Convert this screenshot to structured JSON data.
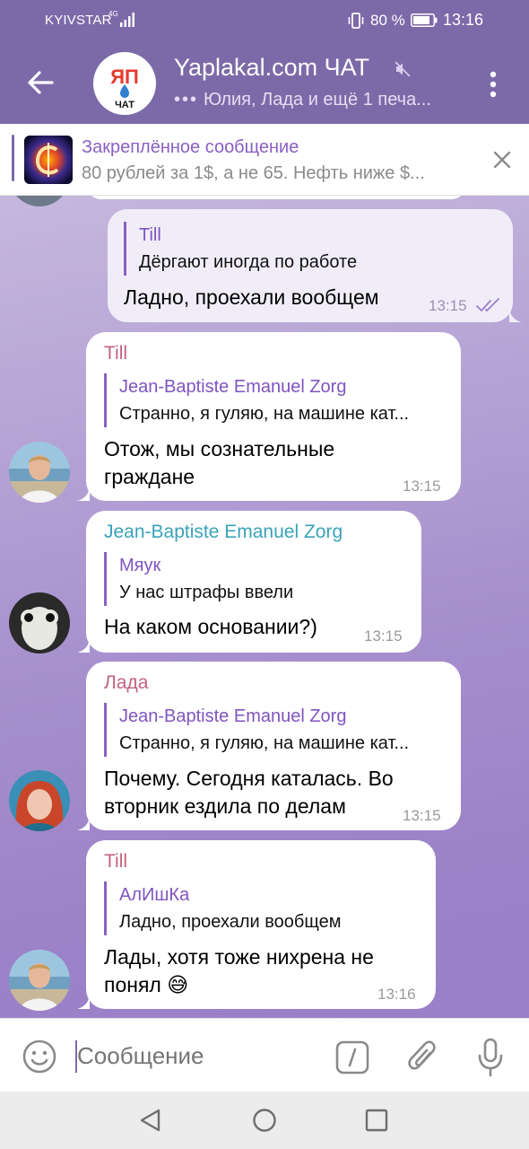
{
  "status_bar": {
    "carrier": "KYIVSTAR",
    "network": "4G",
    "battery_percent": "80 %",
    "time": "13:16"
  },
  "header": {
    "title": "Yaplakal.com ЧАТ",
    "subtitle": "Юлия, Лада и ещё 1 печа...",
    "avatar_text_top": "ЯП",
    "avatar_text_bottom": "ЧАТ",
    "muted": true
  },
  "pinned": {
    "title": "Закреплённое сообщение",
    "text": "80 рублей за 1$, а не 65. Нефть ниже $..."
  },
  "messages": [
    {
      "id": "m1",
      "direction": "out",
      "reply_name": "Till",
      "reply_text": "Дёргают иногда по работе",
      "text": "Ладно, проехали вообщем",
      "time": "13:15",
      "read": true
    },
    {
      "id": "m2",
      "direction": "in",
      "sender": "Till",
      "sender_color": "#c2627e",
      "reply_name": "Jean-Baptiste Emanuel Zorg",
      "reply_text": "Странно, я гуляю, на машине кат...",
      "text_line1": "Отож, мы сознательные",
      "text_line2": "граждане",
      "time": "13:15"
    },
    {
      "id": "m3",
      "direction": "in",
      "sender": "Jean-Baptiste Emanuel Zorg",
      "sender_color": "#3aa2b8",
      "reply_name": "Мяук",
      "reply_text": "У нас штрафы ввели",
      "text": "На каком основании?)",
      "time": "13:15"
    },
    {
      "id": "m4",
      "direction": "in",
      "sender": "Лада",
      "sender_color": "#c2627e",
      "reply_name": "Jean-Baptiste Emanuel Zorg",
      "reply_text": "Странно, я гуляю, на машине кат...",
      "text_line1": "Почему. Сегодня каталась. Во",
      "text_line2": "вторник ездила по делам",
      "time": "13:15"
    },
    {
      "id": "m5",
      "direction": "in",
      "sender": "Till",
      "sender_color": "#c2627e",
      "reply_name": "АлИшКа",
      "reply_text": "Ладно, проехали вообщем",
      "text_line1": "Лады, хотя тоже нихрена не",
      "text_line2": "понял 😅",
      "time": "13:16"
    }
  ],
  "composer": {
    "placeholder": "Сообщение"
  },
  "colors": {
    "accent": "#7c6aa8",
    "reply_bar": "#8a5fc2",
    "name_pink": "#c2627e",
    "name_teal": "#3aa2b8"
  },
  "icons": {
    "back": "arrow-left-icon",
    "mute": "speaker-muted-icon",
    "menu": "vertical-dots-icon",
    "close": "close-icon",
    "emoji": "smiley-icon",
    "bot_command": "slash-command-icon",
    "attach": "paperclip-icon",
    "mic": "microphone-icon",
    "read": "double-check-icon"
  }
}
